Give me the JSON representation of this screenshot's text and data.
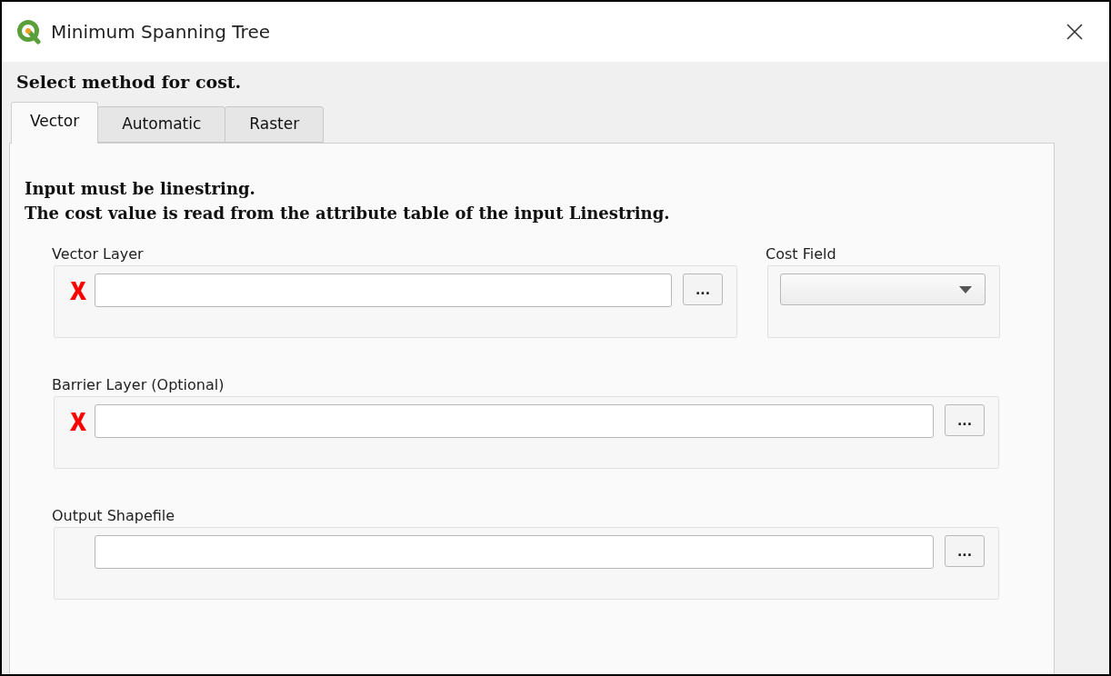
{
  "window": {
    "title": "Minimum Spanning Tree"
  },
  "heading": "Select method for cost.",
  "tabs": [
    {
      "label": "Vector",
      "selected": true
    },
    {
      "label": "Automatic",
      "selected": false
    },
    {
      "label": "Raster",
      "selected": false
    }
  ],
  "instructions": [
    "Input must be linestring.",
    "The cost value is read from the attribute table of the input Linestring."
  ],
  "rows": [
    [
      {
        "kind": "file",
        "label": "Vector Layer",
        "invalid": true,
        "button": "..."
      },
      {
        "kind": "combo",
        "label": "Cost Field"
      }
    ],
    [
      {
        "kind": "file",
        "label": "Barrier Layer (Optional)",
        "invalid": true,
        "button": "..."
      }
    ],
    [
      {
        "kind": "file",
        "label": "Output Shapefile",
        "invalid": false,
        "button": "..."
      }
    ]
  ]
}
